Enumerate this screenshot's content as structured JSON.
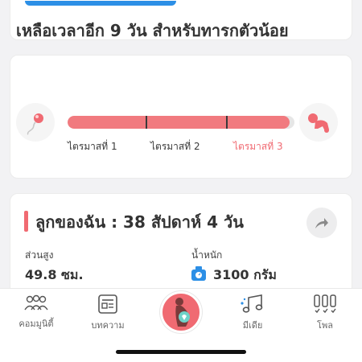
{
  "countdown": {
    "title": "เหลือเวลาอีก 9 วัน สำหรับทารกตัวน้อย",
    "progress_fraction": 0.98,
    "trimesters": [
      "ไตรมาสที่ 1",
      "ไตรมาสที่ 2",
      "ไตรมาสที่ 3"
    ],
    "active_trimester_index": 2
  },
  "baby": {
    "title": "ลูกของฉัน : 38 สัปดาห์ 4  วัน",
    "height_label": "ส่วนสูง",
    "height_value": "49.8 ซม.",
    "weight_label": "น้ำหนัก",
    "weight_value": "3100 กรัม"
  },
  "bottom_nav": {
    "items": [
      {
        "label": "คอมมูนิตี้",
        "icon": "community-icon"
      },
      {
        "label": "บทความ",
        "icon": "article-icon"
      },
      {
        "label": "",
        "icon": "pregnancy-center-icon"
      },
      {
        "label": "มีเดีย",
        "icon": "media-icon"
      },
      {
        "label": "โพล",
        "icon": "poll-icon"
      }
    ]
  },
  "colors": {
    "accent": "#f06a72",
    "progress": "#f17a7f",
    "primary_button": "#2c8fe6"
  }
}
